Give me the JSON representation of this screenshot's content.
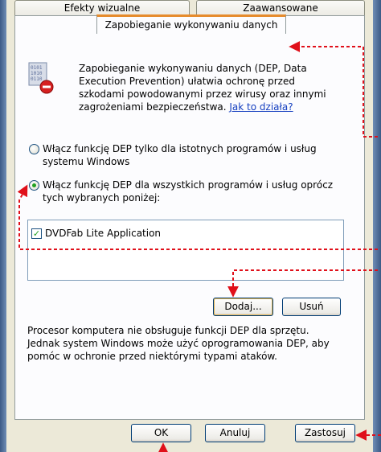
{
  "tabs": [
    {
      "label": "Efekty wizualne"
    },
    {
      "label": "Zaawansowane"
    },
    {
      "label": "Zapobieganie wykonywaniu danych"
    }
  ],
  "description": {
    "line1": "Zapobieganie wykonywaniu danych (DEP, Data",
    "line2": "Execution Prevention) ułatwia ochronę przed",
    "line3": "szkodami powodowanymi przez wirusy oraz innymi",
    "line4": "zagrożeniami bezpieczeństwa.",
    "link": "Jak to działa?"
  },
  "options": {
    "essential_line1": "Włącz funkcję DEP tylko dla istotnych programów i usług",
    "essential_line2": "systemu Windows",
    "all_line1": "Włącz funkcję DEP dla wszystkich programów i usług oprócz",
    "all_line2": "tych wybranych poniżej:",
    "selected": "all"
  },
  "exceptions_list": [
    {
      "label": "DVDFab Lite Application",
      "checked": true
    }
  ],
  "buttons": {
    "add": "Dodaj...",
    "remove": "Usuń",
    "ok": "OK",
    "cancel": "Anuluj",
    "apply": "Zastosuj"
  },
  "info": {
    "line1": "Procesor komputera nie obsługuje funkcji DEP dla sprzętu.",
    "line2": "Jednak system Windows może użyć oprogramowania DEP, aby",
    "line3": "pomóc w ochronie przed niektórymi typami ataków."
  },
  "colors": {
    "annotation": "#e0101a",
    "active_tab_accent": "#e68b2c",
    "radio_dot": "#21a121",
    "link": "#1640c0"
  }
}
